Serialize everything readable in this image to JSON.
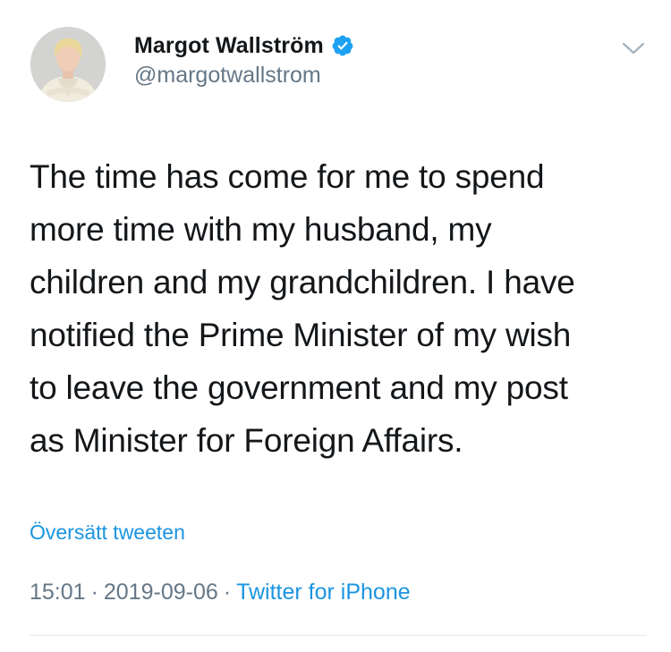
{
  "author": {
    "display_name": "Margot Wallström",
    "handle": "@margotwallstrom",
    "verified": true
  },
  "tweet": {
    "text": "The time has come for me to spend\nmore time with my husband, my\nchildren and my grandchildren. I have\nnotified the Prime Minister of my wish\nto leave the government and my post\nas Minister for Foreign Affairs.",
    "translate_label": "Översätt tweeten"
  },
  "meta": {
    "time": "15:01",
    "separator": "·",
    "date": "2019-09-06",
    "source": "Twitter for iPhone"
  },
  "icons": {
    "verified": "verified-badge-icon",
    "more": "chevron-down-icon"
  },
  "colors": {
    "link": "#1b95e0",
    "secondary": "#657786",
    "primary": "#14171a",
    "verified": "#1da1f2"
  }
}
